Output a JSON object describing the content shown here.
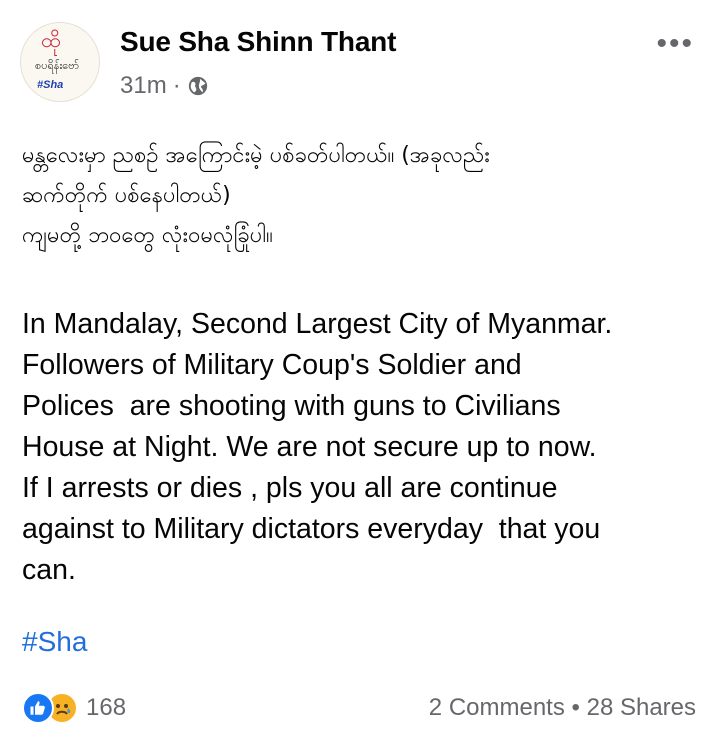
{
  "post": {
    "author": "Sue Sha Shinn Thant",
    "time": "31m",
    "separator": "·",
    "avatar_text": {
      "line1": "ထို",
      "line2": "စပရိန်းဗော်",
      "line3": "#Sha"
    },
    "more_label": "•••",
    "myanmar_lines": [
      "မန္တလေးမှာ ညစဥ် အကြောင်းမဲ့ ပစ်ခတ်ပါတယ်။ (အခုလည်း",
      "ဆက်တိုက် ပစ်နေပါတယ်)",
      "ကျမတို့ ဘဝတွေ လုံးဝမလုံခြုံပါ။"
    ],
    "english_text": "In Mandalay, Second Largest City of Myanmar.\nFollowers of Military Coup's Soldier and\nPolices  are shooting with guns to Civilians\nHouse at Night. We are not secure up to now.\nIf I arrests or dies , pls you all are continue\nagainst to Military dictators everyday  that you\ncan.",
    "hashtag": "#Sha"
  },
  "footer": {
    "reactions_count": "168",
    "reaction_icons": [
      "like-icon",
      "sad-icon"
    ],
    "comments": "2 Comments",
    "dot": "•",
    "shares": "28 Shares"
  },
  "colors": {
    "link": "#216fdb",
    "secondary_text": "#65676b",
    "like_blue": "#1877f2",
    "sad_yellow": "#f7b125"
  }
}
